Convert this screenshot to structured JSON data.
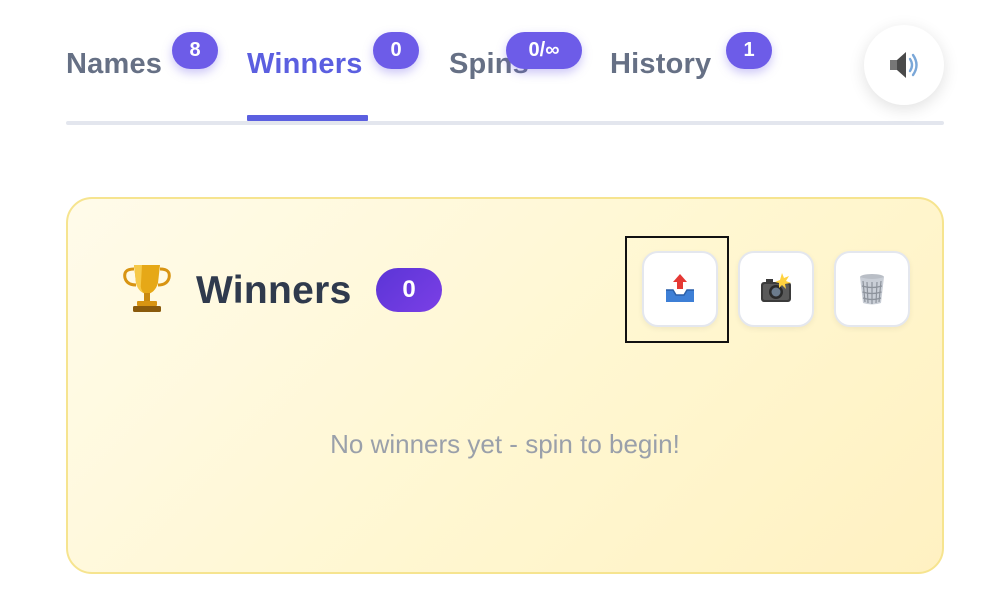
{
  "tabs": [
    {
      "label": "Names",
      "badge": "8",
      "active": false
    },
    {
      "label": "Winners",
      "badge": "0",
      "active": true
    },
    {
      "label": "Spins",
      "badge": "0/∞",
      "active": false
    },
    {
      "label": "History",
      "badge": "1",
      "active": false
    }
  ],
  "sound_button": {
    "icon": "speaker-icon"
  },
  "winners_card": {
    "icon": "trophy-icon",
    "title": "Winners",
    "count": "0",
    "actions": [
      {
        "name": "export-button",
        "icon": "outbox-tray-icon"
      },
      {
        "name": "screenshot-button",
        "icon": "camera-flash-icon"
      },
      {
        "name": "clear-button",
        "icon": "trash-can-icon"
      }
    ],
    "empty_message": "No winners yet - spin to begin!"
  },
  "colors": {
    "accent": "#5b5fe0",
    "badge": "#6d5ce8",
    "inactive_tab": "#667085",
    "card_border": "#f6e48f",
    "card_bg": "#fff7d1",
    "pill": "#6a3ae0",
    "muted_text": "#9aa0aa"
  }
}
